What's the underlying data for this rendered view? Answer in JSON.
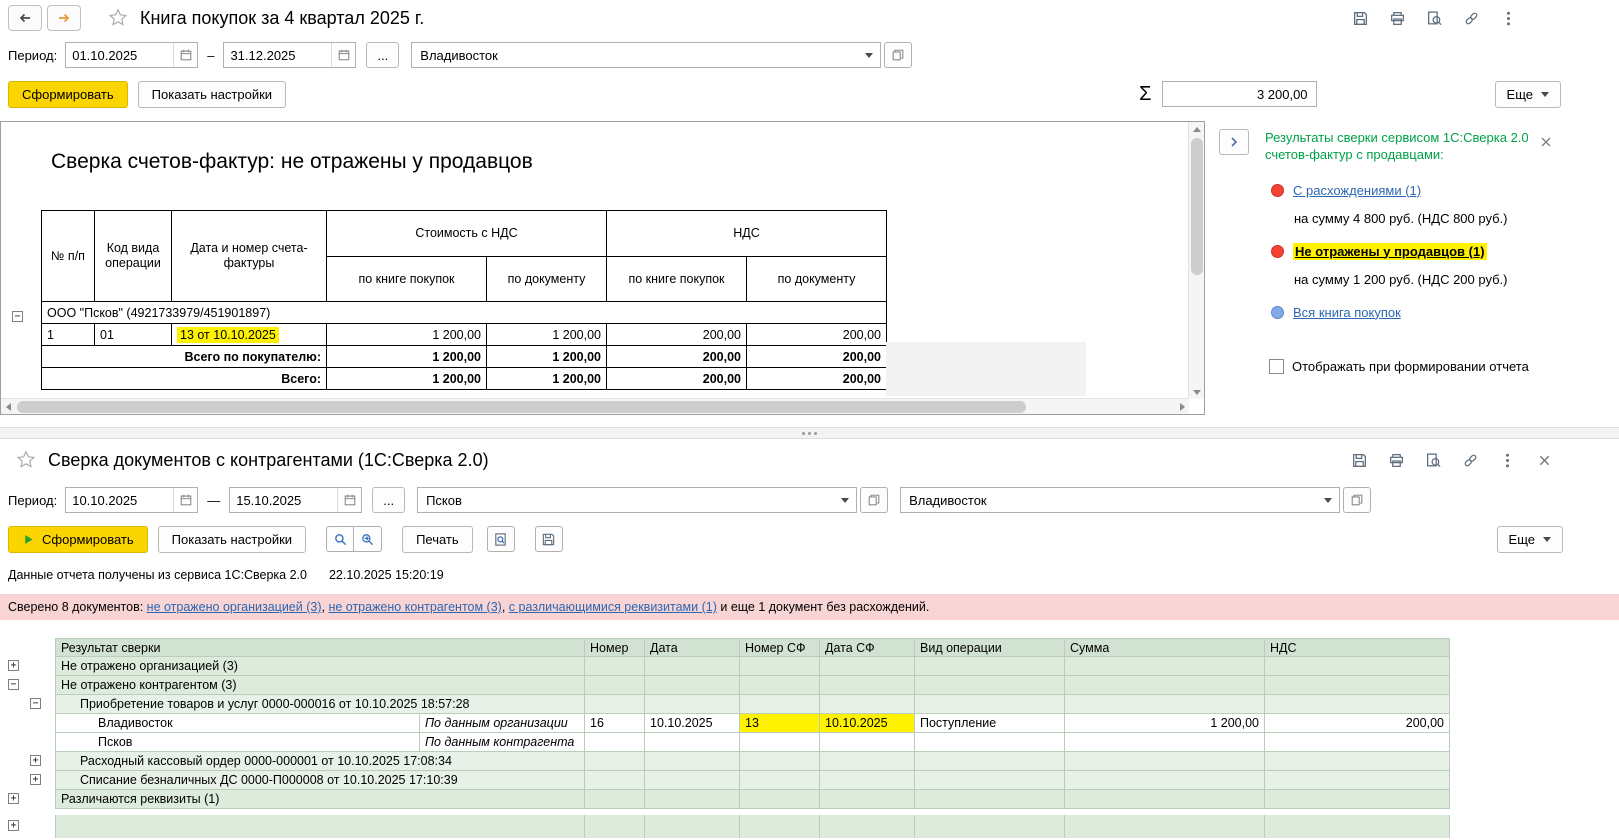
{
  "top": {
    "title": "Книга покупок за 4 квартал 2025 г.",
    "more_label": "Еще",
    "period_label": "Период:",
    "period_from": "01.10.2025",
    "period_dash": "–",
    "period_to": "31.12.2025",
    "period_more": "...",
    "org_value": "Владивосток",
    "generate_label": "Сформировать",
    "settings_label": "Показать настройки",
    "sigma": "Σ",
    "sum_value": "3 200,00",
    "report": {
      "title": "Сверка счетов-фактур: не отражены у продавцов",
      "group_expander": "−",
      "columns": {
        "num": "№ п/п",
        "op_code": "Код вида операции",
        "invoice": "Дата и номер счета-фактуры",
        "cost": "Стоимость с НДС",
        "vat": "НДС",
        "by_book": "по книге покупок",
        "by_doc": "по документу",
        "by_book2": "по книге покупок",
        "by_doc2": "по документу"
      },
      "group_label": "ООО \"Псков\" (4921733979/451901897)",
      "row": {
        "num": "1",
        "code": "01",
        "invoice": "13 от 10.10.2025",
        "cost_book": "1 200,00",
        "cost_doc": "1 200,00",
        "vat_book": "200,00",
        "vat_doc": "200,00"
      },
      "total_buyer": {
        "label": "Всего по покупателю:",
        "cost_book": "1 200,00",
        "cost_doc": "1 200,00",
        "vat_book": "200,00",
        "vat_doc": "200,00"
      },
      "total": {
        "label": "Всего:",
        "cost_book": "1 200,00",
        "cost_doc": "1 200,00",
        "vat_book": "200,00",
        "vat_doc": "200,00"
      }
    },
    "side": {
      "title": "Результаты сверки сервисом 1С:Сверка 2.0 счетов-фактур с продавцами:",
      "discrepancies_link": "С расхождениями (1)",
      "discrepancies_sum": "на сумму 4 800 руб. (НДС 800 руб.)",
      "not_reflected_link": "Не отражены у продавцов (1)",
      "not_reflected_sum": "на сумму 1 200 руб. (НДС 200 руб.)",
      "whole_book_link": "Вся книга покупок",
      "checkbox_label": "Отображать при формировании отчета"
    }
  },
  "bottom": {
    "title": "Сверка документов с контрагентами (1С:Сверка 2.0)",
    "period_label": "Период:",
    "period_from": "10.10.2025",
    "period_dash": "—",
    "period_to": "15.10.2025",
    "period_more": "...",
    "counterparty_value": "Псков",
    "org_value": "Владивосток",
    "generate_label": "Сформировать",
    "settings_label": "Показать настройки",
    "print_label": "Печать",
    "more_label": "Еще",
    "status_text": "Данные отчета получены из сервиса 1С:Сверка 2.0",
    "status_time": "22.10.2025 15:20:19",
    "banner": {
      "prefix": "Сверено 8 документов: ",
      "link_org": "не отражено организацией (3)",
      "sep1": ", ",
      "link_counterparty": "не отражено контрагентом (3)",
      "sep2": ", ",
      "link_diff": "с различающимися реквизитами (1)",
      "suffix": " и еще 1 документ без расхождений."
    },
    "table": {
      "headers": [
        "Результат сверки",
        "Номер",
        "Дата",
        "Номер СФ",
        "Дата СФ",
        "Вид операции",
        "Сумма",
        "НДС"
      ],
      "rows": [
        {
          "expander": "+",
          "label": "Не отражено организацией (3)"
        },
        {
          "expander": "−",
          "label": "Не отражено контрагентом (3)"
        },
        {
          "expander": "−",
          "label": "Приобретение товаров и услуг 0000-000016 от 10.10.2025 18:57:28"
        },
        {
          "name": "Владивосток",
          "source": "По данным организации",
          "number": "16",
          "date": "10.10.2025",
          "sf_number": "13",
          "sf_date": "10.10.2025",
          "operation": "Поступление",
          "sum": "1 200,00",
          "vat": "200,00"
        },
        {
          "name": "Псков",
          "source": "По данным контрагента",
          "number": "",
          "date": "",
          "sf_number": "",
          "sf_date": "",
          "operation": "",
          "sum": "",
          "vat": ""
        },
        {
          "expander": "+",
          "label": "Расходный кассовый ордер 0000-000001 от 10.10.2025 17:08:34"
        },
        {
          "expander": "+",
          "label": "Списание безналичных ДС 0000-П000008 от 10.10.2025 17:10:39"
        },
        {
          "expander": "+",
          "label": "Различаются реквизиты (1)"
        },
        {
          "expander": "+",
          "label": ""
        }
      ]
    }
  }
}
